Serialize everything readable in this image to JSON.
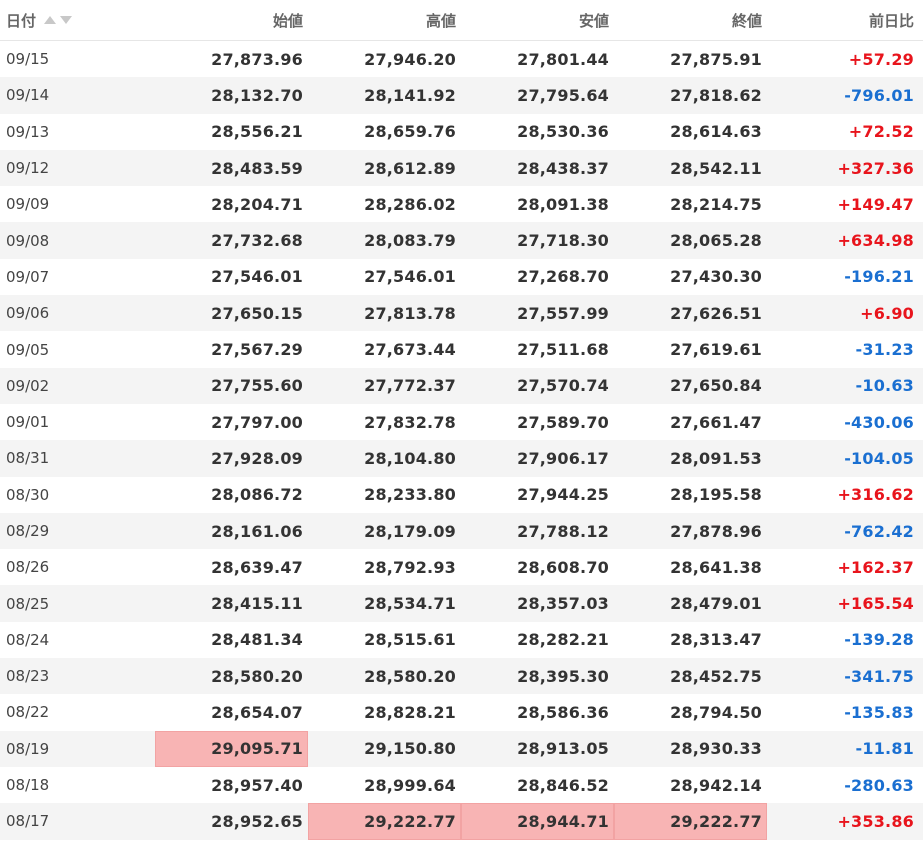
{
  "header": {
    "date": "日付",
    "open": "始値",
    "high": "高値",
    "low": "安値",
    "close": "終値",
    "change": "前日比"
  },
  "colors": {
    "positive": "#e8141c",
    "negative": "#1a6fd1",
    "highlight": "#f8b4b4"
  },
  "rows": [
    {
      "date": "09/15",
      "open": "27,873.96",
      "high": "27,946.20",
      "low": "27,801.44",
      "close": "27,875.91",
      "change": "+57.29",
      "highlight": []
    },
    {
      "date": "09/14",
      "open": "28,132.70",
      "high": "28,141.92",
      "low": "27,795.64",
      "close": "27,818.62",
      "change": "-796.01",
      "highlight": []
    },
    {
      "date": "09/13",
      "open": "28,556.21",
      "high": "28,659.76",
      "low": "28,530.36",
      "close": "28,614.63",
      "change": "+72.52",
      "highlight": []
    },
    {
      "date": "09/12",
      "open": "28,483.59",
      "high": "28,612.89",
      "low": "28,438.37",
      "close": "28,542.11",
      "change": "+327.36",
      "highlight": []
    },
    {
      "date": "09/09",
      "open": "28,204.71",
      "high": "28,286.02",
      "low": "28,091.38",
      "close": "28,214.75",
      "change": "+149.47",
      "highlight": []
    },
    {
      "date": "09/08",
      "open": "27,732.68",
      "high": "28,083.79",
      "low": "27,718.30",
      "close": "28,065.28",
      "change": "+634.98",
      "highlight": []
    },
    {
      "date": "09/07",
      "open": "27,546.01",
      "high": "27,546.01",
      "low": "27,268.70",
      "close": "27,430.30",
      "change": "-196.21",
      "highlight": []
    },
    {
      "date": "09/06",
      "open": "27,650.15",
      "high": "27,813.78",
      "low": "27,557.99",
      "close": "27,626.51",
      "change": "+6.90",
      "highlight": []
    },
    {
      "date": "09/05",
      "open": "27,567.29",
      "high": "27,673.44",
      "low": "27,511.68",
      "close": "27,619.61",
      "change": "-31.23",
      "highlight": []
    },
    {
      "date": "09/02",
      "open": "27,755.60",
      "high": "27,772.37",
      "low": "27,570.74",
      "close": "27,650.84",
      "change": "-10.63",
      "highlight": []
    },
    {
      "date": "09/01",
      "open": "27,797.00",
      "high": "27,832.78",
      "low": "27,589.70",
      "close": "27,661.47",
      "change": "-430.06",
      "highlight": []
    },
    {
      "date": "08/31",
      "open": "27,928.09",
      "high": "28,104.80",
      "low": "27,906.17",
      "close": "28,091.53",
      "change": "-104.05",
      "highlight": []
    },
    {
      "date": "08/30",
      "open": "28,086.72",
      "high": "28,233.80",
      "low": "27,944.25",
      "close": "28,195.58",
      "change": "+316.62",
      "highlight": []
    },
    {
      "date": "08/29",
      "open": "28,161.06",
      "high": "28,179.09",
      "low": "27,788.12",
      "close": "27,878.96",
      "change": "-762.42",
      "highlight": []
    },
    {
      "date": "08/26",
      "open": "28,639.47",
      "high": "28,792.93",
      "low": "28,608.70",
      "close": "28,641.38",
      "change": "+162.37",
      "highlight": []
    },
    {
      "date": "08/25",
      "open": "28,415.11",
      "high": "28,534.71",
      "low": "28,357.03",
      "close": "28,479.01",
      "change": "+165.54",
      "highlight": []
    },
    {
      "date": "08/24",
      "open": "28,481.34",
      "high": "28,515.61",
      "low": "28,282.21",
      "close": "28,313.47",
      "change": "-139.28",
      "highlight": []
    },
    {
      "date": "08/23",
      "open": "28,580.20",
      "high": "28,580.20",
      "low": "28,395.30",
      "close": "28,452.75",
      "change": "-341.75",
      "highlight": []
    },
    {
      "date": "08/22",
      "open": "28,654.07",
      "high": "28,828.21",
      "low": "28,586.36",
      "close": "28,794.50",
      "change": "-135.83",
      "highlight": []
    },
    {
      "date": "08/19",
      "open": "29,095.71",
      "high": "29,150.80",
      "low": "28,913.05",
      "close": "28,930.33",
      "change": "-11.81",
      "highlight": [
        "open"
      ]
    },
    {
      "date": "08/18",
      "open": "28,957.40",
      "high": "28,999.64",
      "low": "28,846.52",
      "close": "28,942.14",
      "change": "-280.63",
      "highlight": []
    },
    {
      "date": "08/17",
      "open": "28,952.65",
      "high": "29,222.77",
      "low": "28,944.71",
      "close": "29,222.77",
      "change": "+353.86",
      "highlight": [
        "high",
        "low",
        "close"
      ]
    }
  ]
}
